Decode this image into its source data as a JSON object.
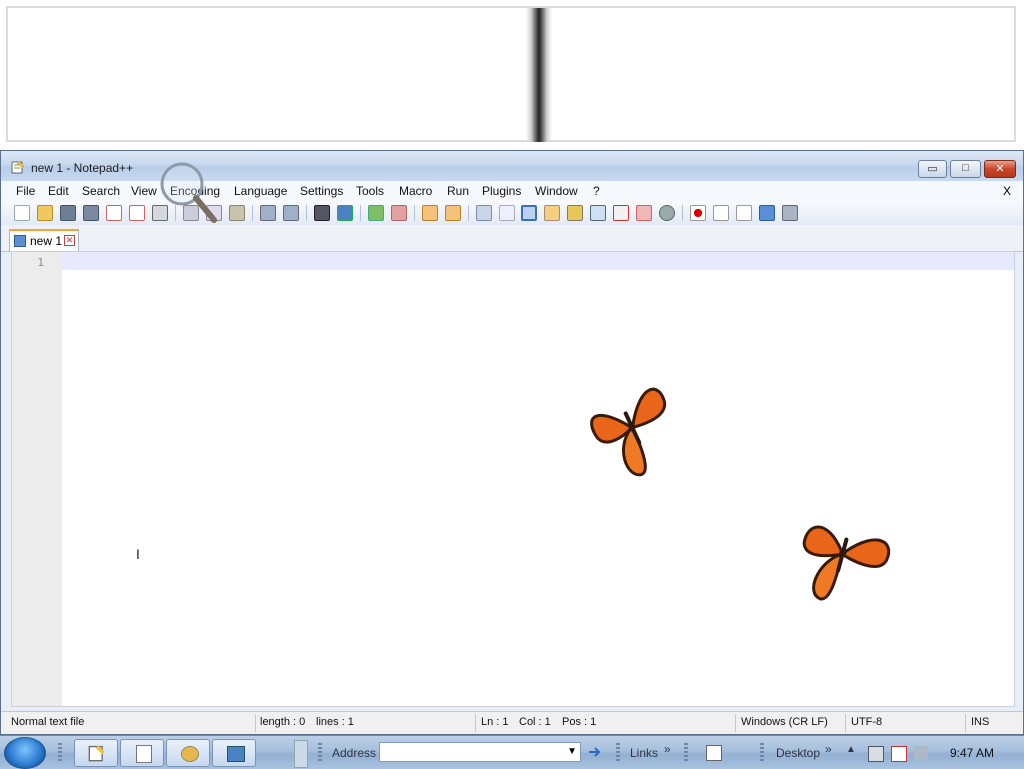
{
  "window": {
    "title": "new 1 - Notepad++",
    "minimize_glyph": "▭",
    "maximize_glyph": "□",
    "close_glyph": "✕"
  },
  "menu": {
    "items": [
      "File",
      "Edit",
      "Search",
      "View",
      "Encoding",
      "Language",
      "Settings",
      "Tools",
      "Macro",
      "Run",
      "Plugins",
      "Window",
      "?"
    ],
    "close_doc": "X"
  },
  "tabs": [
    {
      "label": "new 1"
    }
  ],
  "editor": {
    "line_numbers": [
      "1"
    ],
    "content": ""
  },
  "status": {
    "file_type": "Normal text file",
    "length": "length : 0",
    "lines": "lines : 1",
    "ln": "Ln : 1",
    "col": "Col : 1",
    "pos": "Pos : 1",
    "eol": "Windows (CR LF)",
    "encoding": "UTF-8",
    "mode": "INS"
  },
  "taskbar": {
    "address_label": "Address",
    "address_value": "",
    "links_label": "Links",
    "desktop_label": "Desktop",
    "chevron": "»",
    "clock": "9:47 AM"
  },
  "icons": {
    "toolbar": [
      "new-file-icon",
      "open-file-icon",
      "save-icon",
      "save-all-icon",
      "close-icon",
      "close-all-icon",
      "print-icon",
      "cut-icon",
      "copy-icon",
      "paste-icon",
      "undo-icon",
      "redo-icon",
      "find-icon",
      "replace-icon",
      "zoom-in-icon",
      "zoom-out-icon",
      "sync-vertical-icon",
      "sync-horizontal-icon",
      "word-wrap-icon",
      "show-all-chars-icon",
      "indent-guide-icon",
      "lang-icon",
      "doc-map-icon",
      "function-list-icon",
      "folder-workspace-icon",
      "monitor-icon",
      "record-macro-icon",
      "stop-macro-icon",
      "play-macro-icon",
      "run-macro-multiple-icon",
      "save-macro-icon"
    ]
  },
  "colors": {
    "title_gradient_top": "#dfe9f6",
    "close_button": "#c7472b",
    "current_line": "#e8e8ff",
    "tab_accent": "#f7a234",
    "butterfly": "#e8651a"
  }
}
